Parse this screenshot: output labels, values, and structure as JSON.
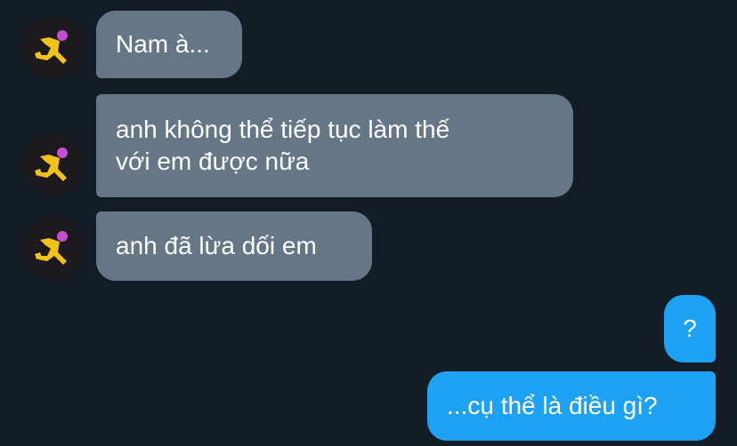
{
  "colors": {
    "background": "#141d26",
    "received_bubble": "#657786",
    "sent_bubble": "#1da1f2",
    "text": "#ffffff"
  },
  "messages": [
    {
      "direction": "received",
      "text": "Nam à..."
    },
    {
      "direction": "received",
      "text": "anh không thể tiếp tục làm thế\nvới em được nữa"
    },
    {
      "direction": "received",
      "text": "anh đã lừa dối em"
    },
    {
      "direction": "sent",
      "text": "?"
    },
    {
      "direction": "sent",
      "text": "...cụ thể là điều gì?"
    }
  ]
}
